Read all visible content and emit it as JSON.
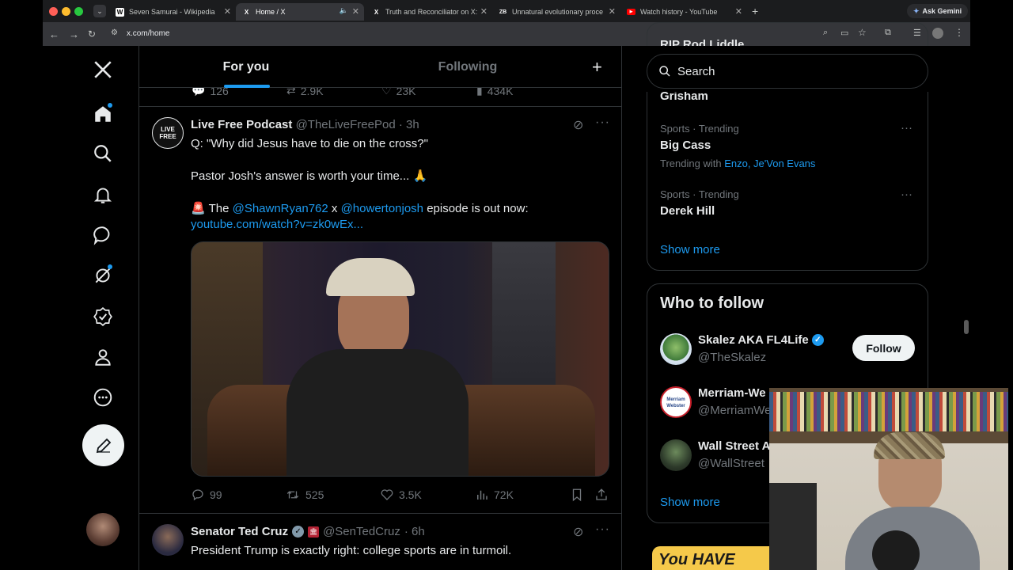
{
  "browser": {
    "tabs": [
      {
        "label": "Seven Samurai - Wikipedia",
        "icon": "W"
      },
      {
        "label": "Home / X",
        "icon": "X"
      },
      {
        "label": "Truth and Reconciliator on X:",
        "icon": "X"
      },
      {
        "label": "Unnatural evolutionary proce",
        "icon": "ZB"
      },
      {
        "label": "Watch history - YouTube",
        "icon": "yt-icon"
      }
    ],
    "new_tab": "+",
    "ask_gemini": "Ask Gemini",
    "url": "x.com/home"
  },
  "feed": {
    "tabs": {
      "for_you": "For you",
      "following": "Following"
    },
    "prev_stats": {
      "replies": "126",
      "reposts": "2.9K",
      "likes": "23K",
      "views": "434K"
    },
    "post1": {
      "avatar_text": "LIVE FREE",
      "name": "Live Free Podcast",
      "handle": "@TheLiveFreePod",
      "time": "· 3h",
      "line1": "Q: \"Why did Jesus have to die on the cross?\"",
      "line2": "Pastor Josh's answer is worth your time... 🙏",
      "line3_prefix": "🚨 The ",
      "mention1": "@ShawnRyan762",
      "line3_mid": " x ",
      "mention2": "@howertonjosh",
      "line3_suffix": " episode is out now:",
      "link": "youtube.com/watch?v=zk0wEx...",
      "stats": {
        "replies": "99",
        "reposts": "525",
        "likes": "3.5K",
        "views": "72K"
      }
    },
    "post2": {
      "name": "Senator Ted Cruz",
      "handle": "@SenTedCruz",
      "time": "· 6h",
      "text": "President Trump is exactly right: college sports are in turmoil."
    }
  },
  "right": {
    "search_placeholder": "Search",
    "cut_top_text": "RIP Rod Liddle",
    "trend0_name": "Grisham",
    "trends": [
      {
        "meta": "Sports · Trending",
        "name": "Big Cass",
        "with_label": "Trending with",
        "with_links": "Enzo, Je'Von Evans"
      },
      {
        "meta": "Sports · Trending",
        "name": "Derek Hill",
        "with_label": "",
        "with_links": ""
      }
    ],
    "show_more": "Show more",
    "who_to_follow": {
      "title": "Who to follow",
      "users": [
        {
          "name": "Skalez AKA FL4Life",
          "handle": "@TheSkalez"
        },
        {
          "name": "Merriam-We",
          "handle": "@MerriamWe",
          "avatar_text": "Merriam Webster"
        },
        {
          "name": "Wall Street A",
          "handle": "@WallStreet"
        }
      ],
      "follow_label": "Follow",
      "show_more": "Show more"
    },
    "promo_text": "You HAVE"
  },
  "colors": {
    "accent": "#1d9bf0",
    "bg": "#000000",
    "border": "#2f3336",
    "muted": "#71767b"
  }
}
